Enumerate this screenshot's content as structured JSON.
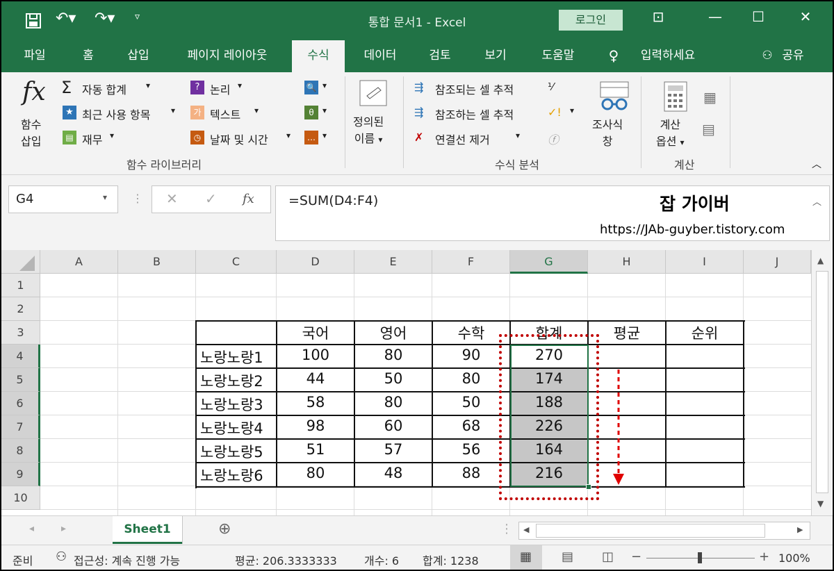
{
  "window": {
    "title": "통합 문서1  -  Excel",
    "login": "로그인"
  },
  "tabs": [
    "파일",
    "홈",
    "삽입",
    "페이지 레이아웃",
    "수식",
    "데이터",
    "검토",
    "보기",
    "도움말",
    "입력하세요",
    "공유"
  ],
  "ribbon": {
    "insert_function": [
      "함수",
      "삽입"
    ],
    "autosum": "자동 합계",
    "recent": "최근 사용 항목",
    "finance": "재무",
    "logic": "논리",
    "text": "텍스트",
    "datetime": "날짜 및 시간",
    "defined_names": [
      "정의된",
      "이름"
    ],
    "trace_prec": "참조되는 셀 추적",
    "trace_dep": "참조하는 셀 추적",
    "remove_arrows": "연결선 제거",
    "watch": [
      "조사식",
      "창"
    ],
    "calc_options": [
      "계산",
      "옵션"
    ],
    "group_library": "함수 라이브러리",
    "group_audit": "수식 분석",
    "group_calc": "계산"
  },
  "formula_bar": {
    "name_box": "G4",
    "fx": "fx",
    "formula": "=SUM(D4:F4)",
    "watermark": "잡 가이버",
    "url": "https://JAb-guyber.tistory.com"
  },
  "columns": [
    "A",
    "B",
    "C",
    "D",
    "E",
    "F",
    "G",
    "H",
    "I",
    "J"
  ],
  "rows": [
    "1",
    "2",
    "3",
    "4",
    "5",
    "6",
    "7",
    "8",
    "9",
    "10"
  ],
  "table": {
    "headers": [
      "국어",
      "영어",
      "수학",
      "합계",
      "평균",
      "순위"
    ],
    "rows": [
      {
        "name": "노랑노랑1",
        "kor": "100",
        "eng": "80",
        "math": "90",
        "sum": "270"
      },
      {
        "name": "노랑노랑2",
        "kor": "44",
        "eng": "50",
        "math": "80",
        "sum": "174"
      },
      {
        "name": "노랑노랑3",
        "kor": "58",
        "eng": "80",
        "math": "50",
        "sum": "188"
      },
      {
        "name": "노랑노랑4",
        "kor": "98",
        "eng": "60",
        "math": "68",
        "sum": "226"
      },
      {
        "name": "노랑노랑5",
        "kor": "51",
        "eng": "57",
        "math": "56",
        "sum": "164"
      },
      {
        "name": "노랑노랑6",
        "kor": "80",
        "eng": "48",
        "math": "88",
        "sum": "216"
      }
    ]
  },
  "sheet": {
    "tab": "Sheet1"
  },
  "status": {
    "ready": "준비",
    "accessibility": "접근성: 계속 진행 가능",
    "average": "평균: 206.3333333",
    "count": "개수: 6",
    "sum": "합계: 1238",
    "zoom": "100%"
  },
  "colors": {
    "excel_green": "#217346",
    "selection_fill": "#c6c6c6",
    "annotation_red": "#c00000"
  }
}
